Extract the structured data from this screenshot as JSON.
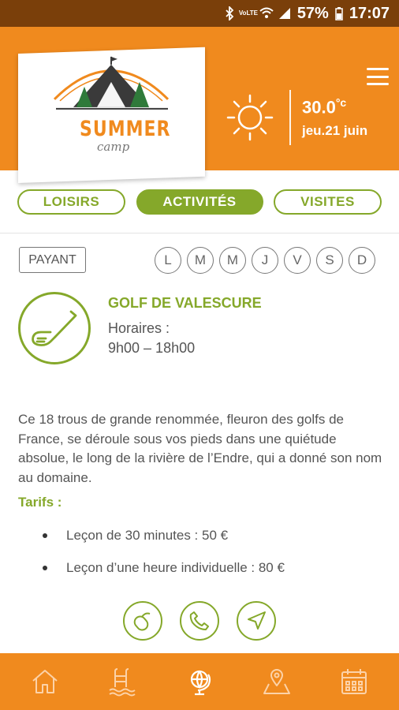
{
  "statusbar": {
    "battery": "57%",
    "time": "17:07",
    "network": "VoLTE"
  },
  "header": {
    "logo_title": "SUMMER",
    "logo_sub": "camp",
    "temperature": "30.0",
    "temperature_unit": "°c",
    "date": "jeu.21 juin",
    "weather_icon": "sun-icon",
    "accent_color": "#f08a1e"
  },
  "tabs": [
    {
      "label": "LOISIRS",
      "active": false
    },
    {
      "label": "ACTIVITÉS",
      "active": true
    },
    {
      "label": "VISITES",
      "active": false
    }
  ],
  "activity": {
    "pricing_badge": "PAYANT",
    "days": [
      "L",
      "M",
      "M",
      "J",
      "V",
      "S",
      "D"
    ],
    "icon": "golf-club-icon",
    "title": "GOLF DE VALESCURE",
    "hours_label": "Horaires :",
    "hours": "9h00 – 18h00",
    "description": "Ce 18 trous de grande renommée, fleuron des golfs de France, se déroule sous vos pieds dans une quiétude absolue, le long de la rivière de l’Endre, qui a donné son nom au domaine.",
    "tarifs_label": "Tarifs :",
    "tarifs": [
      "Leçon de 30 minutes : 50 €",
      "Leçon d’une heure individuelle : 80 €"
    ],
    "green_color": "#85a82a"
  },
  "actions": [
    "mouse-icon",
    "phone-icon",
    "navigation-icon"
  ],
  "bottomnav": [
    "home-icon",
    "pool-icon",
    "globe-icon",
    "map-icon",
    "calendar-icon"
  ]
}
